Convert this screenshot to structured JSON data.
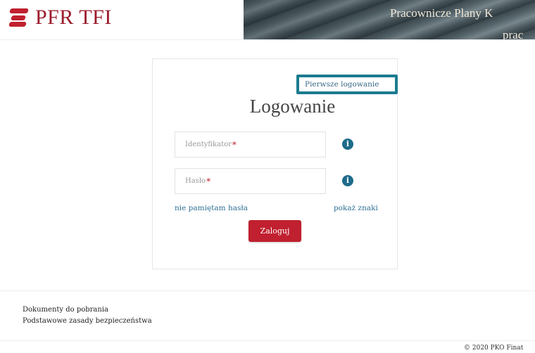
{
  "header": {
    "logo_text": "PFR TFI",
    "logo_icon": "pfr-logo-icon",
    "banner_title": "Pracownicze Plany K",
    "banner_sub": "prac"
  },
  "login": {
    "first_login": "Pierwsze logowanie",
    "title": "Logowanie",
    "identifier_placeholder": "Identyfikator",
    "password_placeholder": "Hasło",
    "required_marker": "*",
    "info_icon": "info-icon",
    "info_glyph": "i",
    "forgot_password": "nie pamiętam hasła",
    "show_chars": "pokaż znaki",
    "submit_label": "Zaloguj"
  },
  "footer": {
    "links": [
      "Dokumenty do pobrania",
      "Podstawowe zasady bezpieczeństwa"
    ],
    "copyright": "© 2020 PKO Finat"
  },
  "colors": {
    "brand_red": "#c0202f",
    "highlight_teal": "#1b7c8f",
    "link_blue": "#2e7096",
    "info_blue": "#1e6b8a"
  }
}
